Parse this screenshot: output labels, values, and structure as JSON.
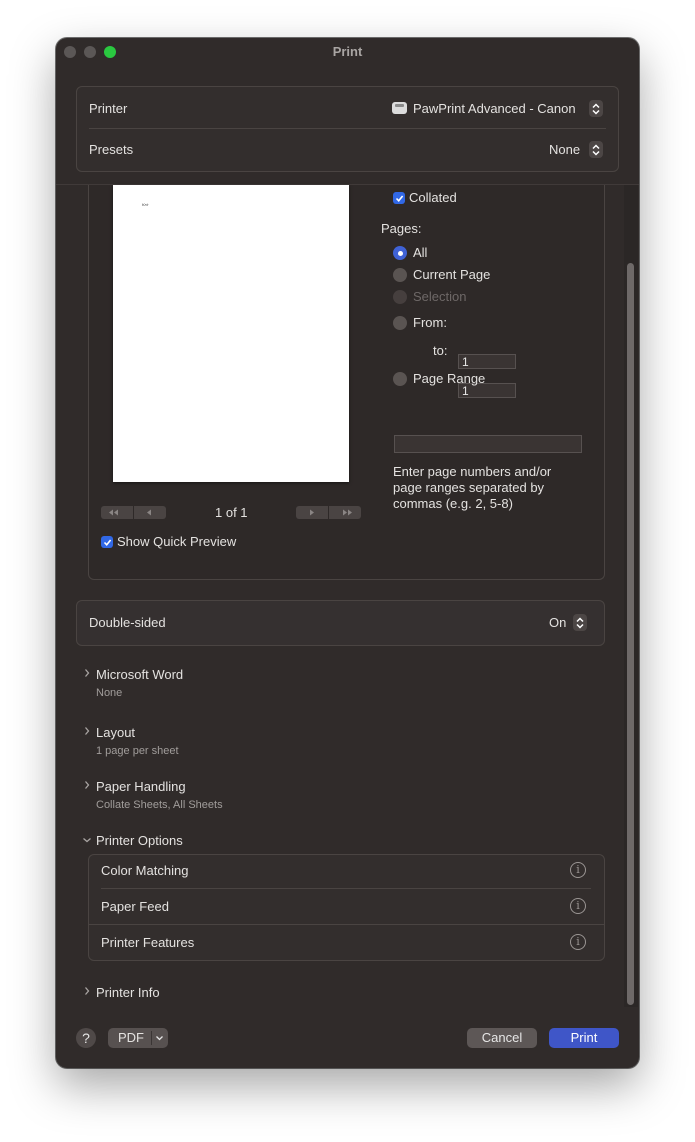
{
  "window": {
    "title": "Print"
  },
  "printer": {
    "label": "Printer",
    "value": "PawPrint Advanced - Canon"
  },
  "presets": {
    "label": "Presets",
    "value": "None"
  },
  "copies": {
    "collated_label": "Collated"
  },
  "pages": {
    "heading": "Pages:",
    "all": "All",
    "current": "Current Page",
    "selection": "Selection",
    "from_label": "From:",
    "from_value": "1",
    "to_label": "to:",
    "to_value": "1",
    "range_label": "Page Range",
    "range_value": "",
    "hint": "Enter page numbers and/or page ranges separated by commas (e.g. 2, 5-8)"
  },
  "preview": {
    "page_text": "Kr/r",
    "page_indicator": "1 of 1",
    "quick_preview_label": "Show Quick Preview"
  },
  "double_sided": {
    "label": "Double-sided",
    "value": "On"
  },
  "sections": {
    "word": {
      "title": "Microsoft Word",
      "summary": "None"
    },
    "layout": {
      "title": "Layout",
      "summary": "1 page per sheet"
    },
    "paper": {
      "title": "Paper Handling",
      "summary": "Collate Sheets, All Sheets"
    },
    "options": {
      "title": "Printer Options"
    },
    "info": {
      "title": "Printer Info"
    }
  },
  "printer_options": {
    "color": "Color Matching",
    "feed": "Paper Feed",
    "features": "Printer Features"
  },
  "footer": {
    "help": "?",
    "pdf": "PDF",
    "cancel": "Cancel",
    "print": "Print"
  },
  "colors": {
    "accent": "#3f56c8",
    "window_bg": "#302b2a"
  },
  "icons": {
    "printer": "printer-icon",
    "stepper": "up-down-chevron-icon",
    "disclosure": "chevron-right-icon",
    "expanded": "chevron-down-icon",
    "info": "info-circle-icon"
  }
}
